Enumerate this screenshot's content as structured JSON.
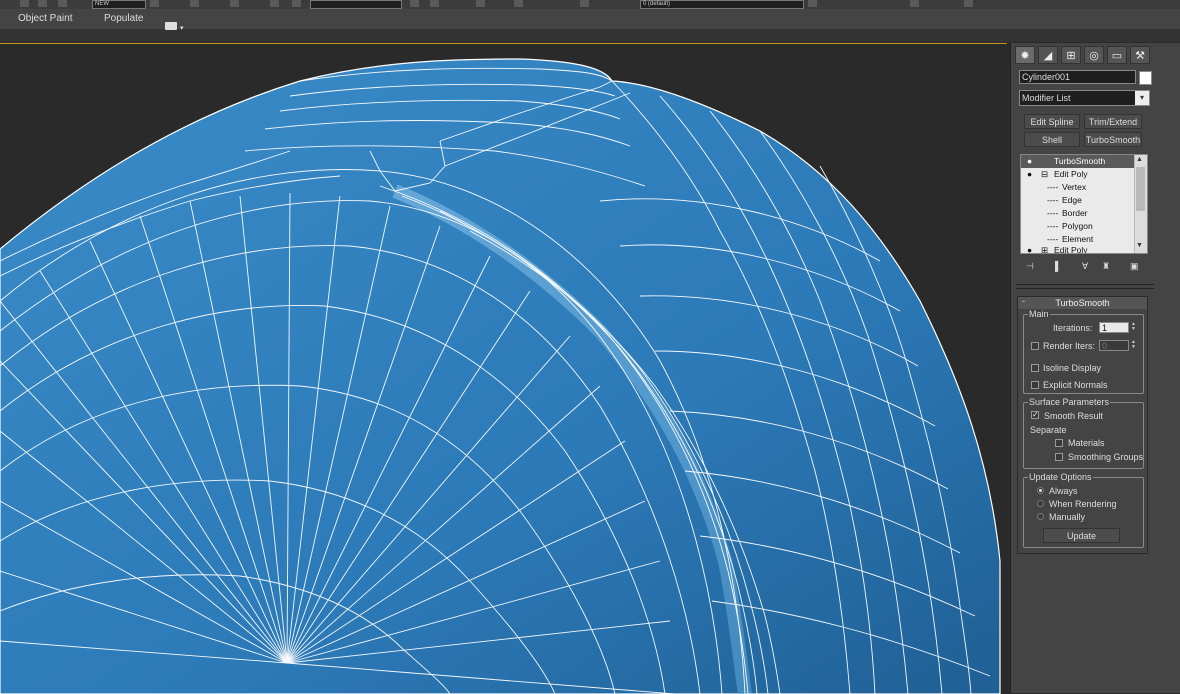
{
  "toolbar": {
    "selection_field": "NEW",
    "named_set_field": "0 (default)"
  },
  "ribbon": {
    "tab_object_paint": "Object Paint",
    "tab_populate": "Populate"
  },
  "viewport": {
    "mesh_color": "#2d7ab8",
    "wire_color": "#ffffff"
  },
  "command_panel": {
    "object_name": "Cylinder001",
    "modifier_list": "Modifier List",
    "buttons": {
      "edit_spline": "Edit Spline",
      "trim_extend": "Trim/Extend",
      "shell": "Shell",
      "turbosmooth": "TurboSmooth"
    },
    "stack": {
      "turbosmooth": "TurboSmooth",
      "edit_poly": "Edit Poly",
      "vertex": "Vertex",
      "edge": "Edge",
      "border": "Border",
      "polygon": "Polygon",
      "element": "Element",
      "edit_poly_2": "Edit Poly"
    },
    "rollout": {
      "title": "TurboSmooth",
      "main_group": "Main",
      "iterations_label": "Iterations:",
      "iterations_value": "1",
      "render_iters_label": "Render Iters:",
      "render_iters_value": "0",
      "isoline_display": "Isoline Display",
      "explicit_normals": "Explicit Normals",
      "surface_group": "Surface Parameters",
      "smooth_result": "Smooth Result",
      "separate": "Separate",
      "materials": "Materials",
      "smoothing_groups": "Smoothing Groups",
      "update_group": "Update Options",
      "always": "Always",
      "when_rendering": "When Rendering",
      "manually": "Manually",
      "update_button": "Update"
    }
  }
}
